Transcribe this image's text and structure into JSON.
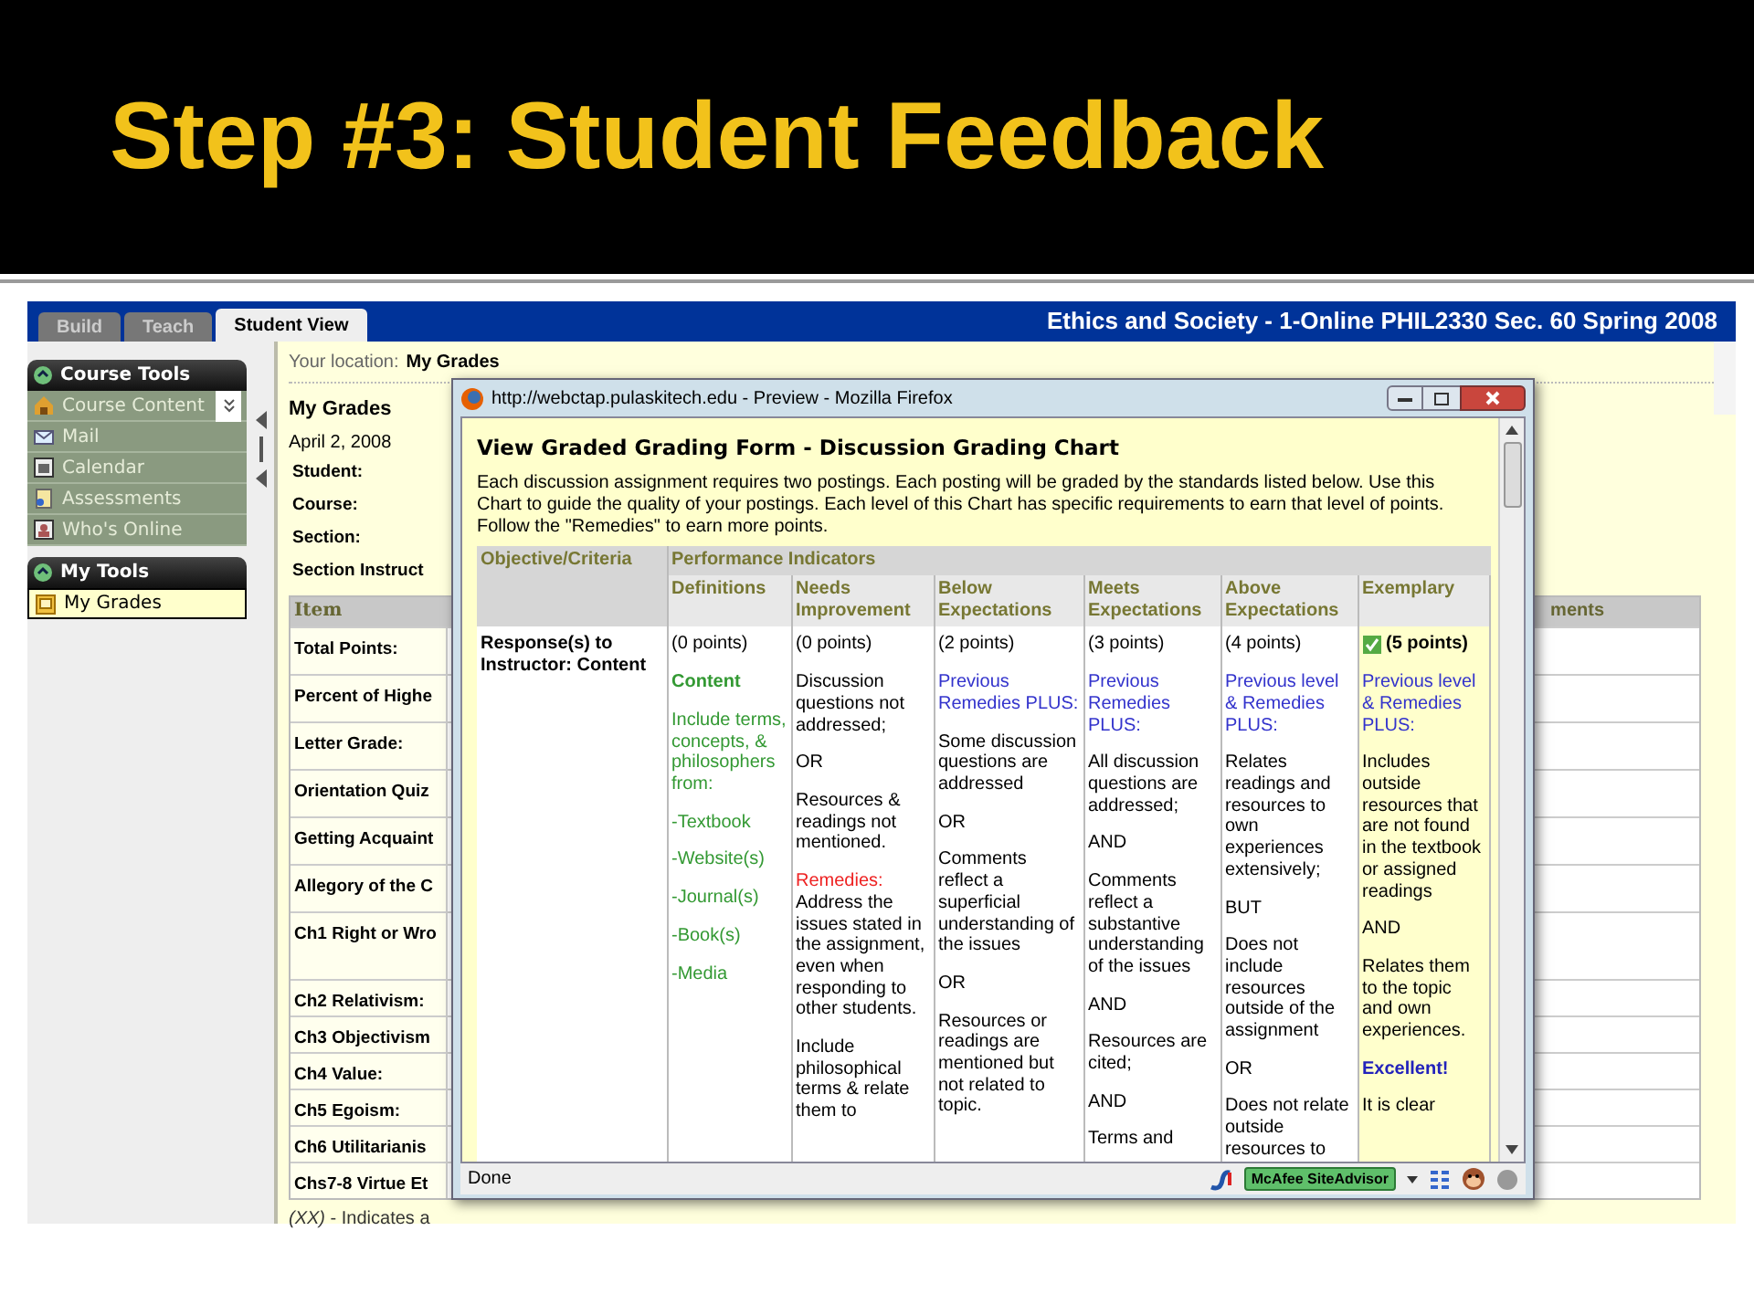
{
  "slide": {
    "title": "Step #3: Student Feedback"
  },
  "app": {
    "tabs": [
      {
        "label": "Build",
        "selected": false
      },
      {
        "label": "Teach",
        "selected": false
      },
      {
        "label": "Student View",
        "selected": true
      }
    ],
    "course_title": "Ethics and Society - 1-Online PHIL2330 Sec. 60 Spring 2008",
    "sidebar": [
      {
        "title": "Course Tools",
        "items": [
          {
            "label": "Course Content",
            "selected": false
          },
          {
            "label": "Mail",
            "selected": false
          },
          {
            "label": "Calendar",
            "selected": false
          },
          {
            "label": "Assessments",
            "selected": false
          },
          {
            "label": "Who's Online",
            "selected": false
          }
        ]
      },
      {
        "title": "My Tools",
        "items": [
          {
            "label": "My Grades",
            "selected": true
          }
        ]
      }
    ],
    "location": {
      "label": "Your location:",
      "value": "My Grades"
    },
    "page_title": "My Grades",
    "date": "April 2, 2008",
    "info_labels": [
      "Student:",
      "Course:",
      "Section:",
      "Section Instruct"
    ],
    "grades_table": {
      "columns": [
        "Item",
        "ments"
      ],
      "rows": [
        "Total Points:",
        "Percent of Highe",
        "Letter Grade:",
        "Orientation Quiz",
        "Getting Acquaint",
        "Allegory of the C",
        "Ch1 Right or Wro",
        "Ch2 Relativism:",
        "Ch3 Objectivism",
        "Ch4 Value:",
        "Ch5 Egoism:",
        "Ch6 Utilitarianis",
        "Chs7-8 Virtue Et"
      ]
    },
    "footnote": "*(XX)* - Indicates a"
  },
  "popup": {
    "title": "http://webctap.pulaskitech.edu - Preview - Mozilla Firefox",
    "heading": "View Graded Grading Form - Discussion Grading Chart",
    "intro": "Each discussion assignment requires two postings. Each posting will be graded by the standards listed below. Use this Chart to guide the quality of your postings. Each level of this Chart has specific requirements to earn that level of points. Follow the \"Remedies\" to earn more points.",
    "rubric": {
      "criteria_header": "Objective/Criteria",
      "group_header": "Performance Indicators",
      "criterion": "Response(s) to Instructor: Content",
      "columns": [
        {
          "header": "Definitions",
          "points": "(0 points)",
          "selected": false,
          "paragraphs": [
            {
              "kind": "heading",
              "text": "Content"
            },
            {
              "kind": "green",
              "text": "Include terms, concepts, & philosophers from:"
            },
            {
              "kind": "green",
              "text": "-Textbook"
            },
            {
              "kind": "green",
              "text": "-Website(s)"
            },
            {
              "kind": "green",
              "text": "-Journal(s)"
            },
            {
              "kind": "green",
              "text": "-Book(s)"
            },
            {
              "kind": "green",
              "text": "-Media"
            }
          ]
        },
        {
          "header": "Needs Improvement",
          "points": "(0 points)",
          "selected": false,
          "paragraphs": [
            {
              "kind": "plain",
              "text": "Discussion questions not addressed;"
            },
            {
              "kind": "plain",
              "text": "OR"
            },
            {
              "kind": "plain",
              "text": "Resources & readings not mentioned."
            },
            {
              "kind": "remedies",
              "text": "Remedies:"
            },
            {
              "kind": "plain",
              "text": "Address the issues stated in the assignment, even when responding to other students."
            },
            {
              "kind": "plain",
              "text": "Include philosophical terms & relate them to"
            }
          ]
        },
        {
          "header": "Below Expectations",
          "points": "(2 points)",
          "selected": false,
          "paragraphs": [
            {
              "kind": "blue",
              "text": "Previous Remedies PLUS:"
            },
            {
              "kind": "plain",
              "text": "Some discussion questions are addressed"
            },
            {
              "kind": "plain",
              "text": "OR"
            },
            {
              "kind": "plain",
              "text": "Comments reflect a superficial understanding of the issues"
            },
            {
              "kind": "plain",
              "text": "OR"
            },
            {
              "kind": "plain",
              "text": "Resources or readings are mentioned but not related to topic."
            }
          ]
        },
        {
          "header": "Meets Expectations",
          "points": "(3 points)",
          "selected": false,
          "paragraphs": [
            {
              "kind": "blue",
              "text": "Previous Remedies PLUS:"
            },
            {
              "kind": "plain",
              "text": "All discussion questions are addressed;"
            },
            {
              "kind": "plain",
              "text": "AND"
            },
            {
              "kind": "plain",
              "text": "Comments reflect a substantive understanding of the issues"
            },
            {
              "kind": "plain",
              "text": "AND"
            },
            {
              "kind": "plain",
              "text": "Resources are cited;"
            },
            {
              "kind": "plain",
              "text": "AND"
            },
            {
              "kind": "plain",
              "text": "Terms and"
            }
          ]
        },
        {
          "header": "Above Expectations",
          "points": "(4 points)",
          "selected": false,
          "paragraphs": [
            {
              "kind": "blue",
              "text": "Previous level & Remedies PLUS:"
            },
            {
              "kind": "plain",
              "text": "Relates readings and resources to own experiences extensively;"
            },
            {
              "kind": "plain",
              "text": "BUT"
            },
            {
              "kind": "plain",
              "text": "Does not include resources outside of the assignment"
            },
            {
              "kind": "plain",
              "text": "OR"
            },
            {
              "kind": "plain",
              "text": "Does not relate outside resources to"
            }
          ]
        },
        {
          "header": "Exemplary",
          "points": "(5 points)",
          "selected": true,
          "paragraphs": [
            {
              "kind": "blue",
              "text": "Previous level & Remedies PLUS:"
            },
            {
              "kind": "plain",
              "text": "Includes outside resources that are not found in the textbook or assigned readings"
            },
            {
              "kind": "plain",
              "text": "AND"
            },
            {
              "kind": "plain",
              "text": "Relates them to the topic and own experiences."
            },
            {
              "kind": "emphasis",
              "text": "Excellent!"
            },
            {
              "kind": "plain",
              "text": "It is clear"
            }
          ]
        }
      ]
    },
    "status": "Done",
    "badge": "McAfee SiteAdvisor"
  }
}
